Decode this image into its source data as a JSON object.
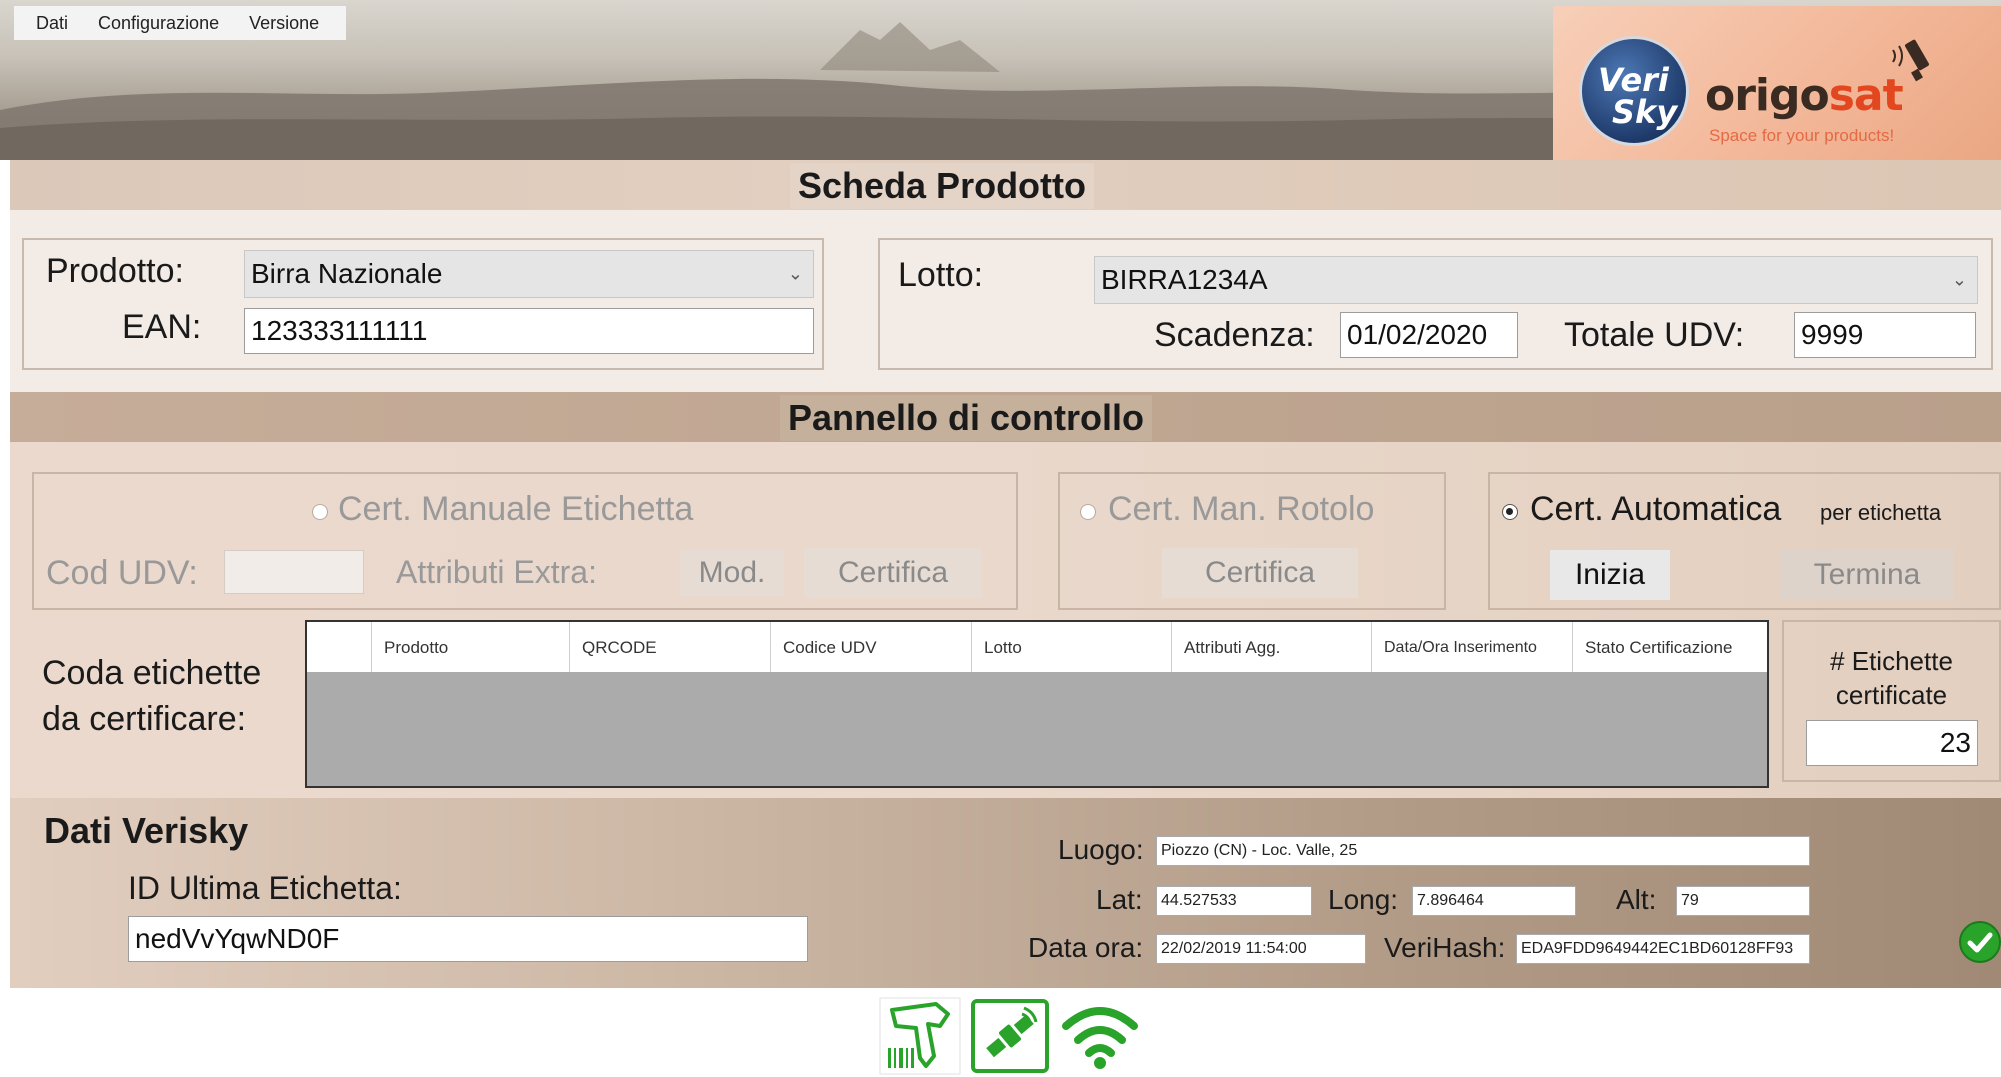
{
  "menu": {
    "items": [
      "Dati",
      "Configurazione",
      "Versione"
    ]
  },
  "branding": {
    "verisky_line1": "Veri",
    "verisky_line2": "Sky",
    "origosat_part1": "origo",
    "origosat_part2": "sat",
    "origosat_tagline": "Space for your products!"
  },
  "scheda": {
    "title": "Scheda Prodotto",
    "prodotto_label": "Prodotto:",
    "prodotto_value": "Birra Nazionale",
    "ean_label": "EAN:",
    "ean_value": "123333111111",
    "lotto_label": "Lotto:",
    "lotto_value": "BIRRA1234A",
    "scadenza_label": "Scadenza:",
    "scadenza_value": "01/02/2020",
    "totale_label": "Totale UDV:",
    "totale_value": "9999"
  },
  "pannello": {
    "title": "Pannello di controllo",
    "manuale": {
      "radio_label": "Cert. Manuale Etichetta",
      "cod_udv_label": "Cod UDV:",
      "cod_udv_value": "",
      "attributi_label": "Attributi Extra:",
      "mod_button": "Mod.",
      "certifica_button": "Certifica"
    },
    "rotolo": {
      "radio_label": "Cert. Man. Rotolo",
      "certifica_button": "Certifica"
    },
    "automatica": {
      "radio_label": "Cert. Automatica",
      "radio_suffix": "per etichetta",
      "inizia_button": "Inizia",
      "termina_button": "Termina"
    },
    "coda": {
      "label_line1": "Coda etichette",
      "label_line2": "da certificare:",
      "columns": [
        "",
        "Prodotto",
        "QRCODE",
        "Codice UDV",
        "Lotto",
        "Attributi Agg.",
        "Data/Ora Inserimento",
        "Stato Certificazione"
      ],
      "rows": []
    },
    "counter": {
      "label_line1": "# Etichette",
      "label_line2": "certificate",
      "value": "23"
    }
  },
  "verisky": {
    "title": "Dati Verisky",
    "id_label": "ID Ultima Etichetta:",
    "id_value": "nedVvYqwND0F",
    "luogo_label": "Luogo:",
    "luogo_value": "Piozzo (CN) - Loc. Valle, 25",
    "lat_label": "Lat:",
    "lat_value": "44.527533",
    "long_label": "Long:",
    "long_value": "7.896464",
    "alt_label": "Alt:",
    "alt_value": "79",
    "dataora_label": "Data ora:",
    "dataora_value": "22/02/2019 11:54:00",
    "verihash_label": "VeriHash:",
    "verihash_value": "EDA9FDD9649442EC1BD60128FF93"
  },
  "status_icons": [
    "barcode-scanner-icon",
    "satellite-icon",
    "wifi-icon",
    "check-icon"
  ],
  "colors": {
    "accent_green": "#2aa32a",
    "brand_orange": "#e2471f"
  }
}
